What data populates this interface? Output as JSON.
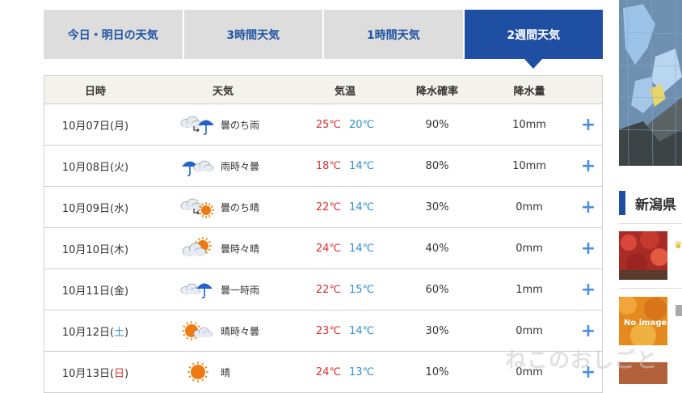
{
  "tabs": [
    {
      "label": "今日・明日の天気",
      "active": false
    },
    {
      "label": "3時間天気",
      "active": false
    },
    {
      "label": "1時間天気",
      "active": false
    },
    {
      "label": "2週間天気",
      "active": true
    }
  ],
  "table": {
    "headers": {
      "date": "日時",
      "weather": "天気",
      "temp": "気温",
      "prob": "降水確率",
      "amount": "降水量"
    },
    "rows": [
      {
        "date_main": "10月07日(",
        "dow": "月",
        "date_end": ")",
        "dow_class": "",
        "icon": "cloudy-then-rain-icon",
        "weather": "曇のち雨",
        "high": "25℃",
        "low": "20℃",
        "prob": "90%",
        "amount": "10mm",
        "expand": "+"
      },
      {
        "date_main": "10月08日(",
        "dow": "火",
        "date_end": ")",
        "dow_class": "",
        "icon": "rain-sometimes-cloudy-icon",
        "weather": "雨時々曇",
        "high": "18℃",
        "low": "14℃",
        "prob": "80%",
        "amount": "10mm",
        "expand": "+"
      },
      {
        "date_main": "10月09日(",
        "dow": "水",
        "date_end": ")",
        "dow_class": "",
        "icon": "cloudy-then-sunny-icon",
        "weather": "曇のち晴",
        "high": "22℃",
        "low": "14℃",
        "prob": "30%",
        "amount": "0mm",
        "expand": "+"
      },
      {
        "date_main": "10月10日(",
        "dow": "木",
        "date_end": ")",
        "dow_class": "",
        "icon": "cloudy-sometimes-sunny-icon",
        "weather": "曇時々晴",
        "high": "24℃",
        "low": "14℃",
        "prob": "40%",
        "amount": "0mm",
        "expand": "+"
      },
      {
        "date_main": "10月11日(",
        "dow": "金",
        "date_end": ")",
        "dow_class": "",
        "icon": "cloudy-brief-rain-icon",
        "weather": "曇一時雨",
        "high": "22℃",
        "low": "15℃",
        "prob": "60%",
        "amount": "1mm",
        "expand": "+"
      },
      {
        "date_main": "10月12日(",
        "dow": "土",
        "date_end": ")",
        "dow_class": "sat",
        "icon": "sunny-sometimes-cloudy-icon",
        "weather": "晴時々曇",
        "high": "23℃",
        "low": "14℃",
        "prob": "30%",
        "amount": "0mm",
        "expand": "+"
      },
      {
        "date_main": "10月13日(",
        "dow": "日",
        "date_end": ")",
        "dow_class": "sun",
        "icon": "sunny-icon",
        "weather": "晴",
        "high": "24℃",
        "low": "13℃",
        "prob": "10%",
        "amount": "0mm",
        "expand": "+"
      }
    ]
  },
  "sidebar": {
    "title": "新潟県",
    "thumb_text": "No image"
  },
  "watermark": "ねこのおしごと",
  "colors": {
    "accent": "#1f4fa3",
    "high_temp": "#d93030",
    "low_temp": "#2e8fd4",
    "expand": "#4a90e2"
  }
}
